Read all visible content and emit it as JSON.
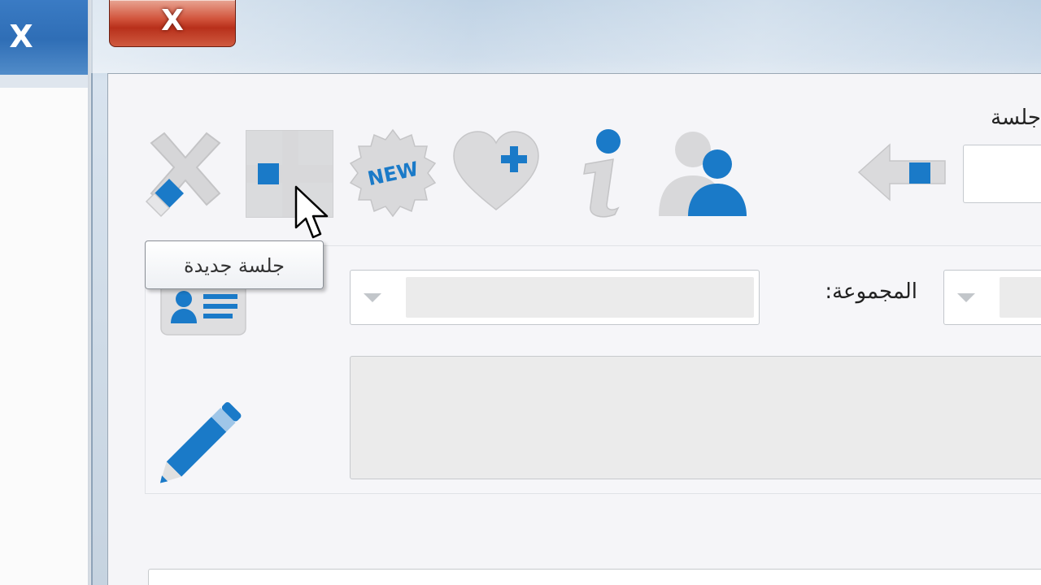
{
  "window": {
    "close_glyph": "X",
    "bg_close_glyph": "X"
  },
  "toolbar": {
    "items": [
      {
        "name": "delete-tool",
        "icon": "x-eraser-icon"
      },
      {
        "name": "new-session-tool",
        "icon": "plus-icon"
      },
      {
        "name": "new-badge-tool",
        "icon": "new-badge-icon",
        "badge_text": "NEW"
      },
      {
        "name": "favorite-add-tool",
        "icon": "heart-plus-icon"
      },
      {
        "name": "info-tool",
        "icon": "info-icon"
      },
      {
        "name": "users-tool",
        "icon": "users-icon"
      },
      {
        "name": "back-tool",
        "icon": "arrow-left-icon"
      }
    ],
    "session_label": "جلسة"
  },
  "tooltip": {
    "text": "جلسة جديدة"
  },
  "form": {
    "group_label": "المجموعة:",
    "group_value": "",
    "session_select_value": "",
    "notes_value": ""
  },
  "colors": {
    "accent_blue": "#1a7ac8",
    "icon_gray": "#d4d4d4",
    "close_red": "#c9412a"
  }
}
